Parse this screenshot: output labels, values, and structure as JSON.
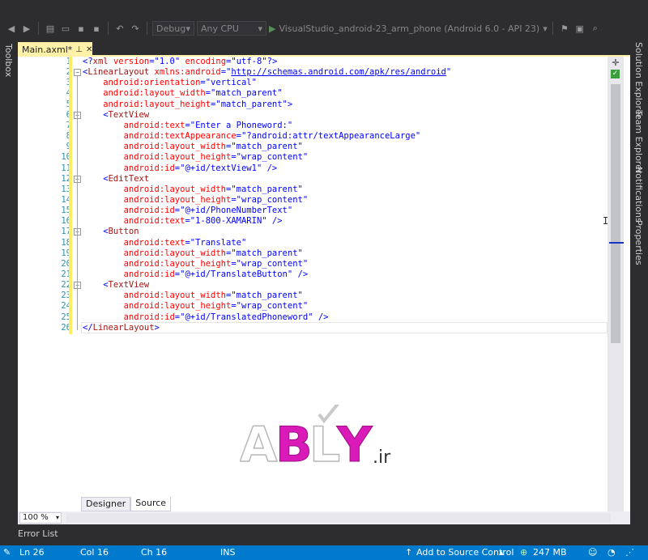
{
  "toolbar": {
    "config": "Debug",
    "platform": "Any CPU",
    "run_target": "VisualStudio_android-23_arm_phone (Android 6.0 - API 23)"
  },
  "side": {
    "left": "Toolbox",
    "right": [
      "Solution Explorer",
      "Team Explorer",
      "Notifications",
      "Properties"
    ]
  },
  "document_tab": {
    "title": "Main.axml*"
  },
  "editor": {
    "line_numbers": [
      "1",
      "2",
      "3",
      "4",
      "5",
      "6",
      "7",
      "8",
      "9",
      "10",
      "11",
      "12",
      "13",
      "14",
      "15",
      "16",
      "17",
      "18",
      "19",
      "20",
      "21",
      "22",
      "23",
      "24",
      "25",
      "26"
    ],
    "lines": [
      [
        {
          "t": "<?",
          "c": "brk"
        },
        {
          "t": "xml",
          "c": "tag"
        },
        {
          "t": " version",
          "c": "attr"
        },
        {
          "t": "=",
          "c": "brk"
        },
        {
          "t": "\"1.0\"",
          "c": "val"
        },
        {
          "t": " encoding",
          "c": "attr"
        },
        {
          "t": "=",
          "c": "brk"
        },
        {
          "t": "\"utf-8\"",
          "c": "val"
        },
        {
          "t": "?>",
          "c": "brk"
        }
      ],
      [
        {
          "t": "<",
          "c": "brk"
        },
        {
          "t": "LinearLayout",
          "c": "tag"
        },
        {
          "t": " xmlns:android",
          "c": "attr"
        },
        {
          "t": "=",
          "c": "brk"
        },
        {
          "t": "\"",
          "c": "val"
        },
        {
          "t": "http://schemas.android.com/apk/res/android",
          "c": "link"
        },
        {
          "t": "\"",
          "c": "val"
        }
      ],
      [
        {
          "t": "    android:orientation",
          "c": "attr"
        },
        {
          "t": "=",
          "c": "brk"
        },
        {
          "t": "\"vertical\"",
          "c": "val"
        }
      ],
      [
        {
          "t": "    android:layout_width",
          "c": "attr"
        },
        {
          "t": "=",
          "c": "brk"
        },
        {
          "t": "\"match_parent\"",
          "c": "val"
        }
      ],
      [
        {
          "t": "    android:layout_height",
          "c": "attr"
        },
        {
          "t": "=",
          "c": "brk"
        },
        {
          "t": "\"match_parent\"",
          "c": "val"
        },
        {
          "t": ">",
          "c": "brk"
        }
      ],
      [
        {
          "t": "    <",
          "c": "brk"
        },
        {
          "t": "TextView",
          "c": "tag"
        }
      ],
      [
        {
          "t": "        android:text",
          "c": "attr"
        },
        {
          "t": "=",
          "c": "brk"
        },
        {
          "t": "\"Enter a Phoneword:\"",
          "c": "val"
        }
      ],
      [
        {
          "t": "        android:textAppearance",
          "c": "attr"
        },
        {
          "t": "=",
          "c": "brk"
        },
        {
          "t": "\"?android:attr/textAppearanceLarge\"",
          "c": "val"
        }
      ],
      [
        {
          "t": "        android:layout_width",
          "c": "attr"
        },
        {
          "t": "=",
          "c": "brk"
        },
        {
          "t": "\"match_parent\"",
          "c": "val"
        }
      ],
      [
        {
          "t": "        android:layout_height",
          "c": "attr"
        },
        {
          "t": "=",
          "c": "brk"
        },
        {
          "t": "\"wrap_content\"",
          "c": "val"
        }
      ],
      [
        {
          "t": "        android:id",
          "c": "attr"
        },
        {
          "t": "=",
          "c": "brk"
        },
        {
          "t": "\"@+id/textView1\"",
          "c": "val"
        },
        {
          "t": " />",
          "c": "brk"
        }
      ],
      [
        {
          "t": "    <",
          "c": "brk"
        },
        {
          "t": "EditText",
          "c": "tag"
        }
      ],
      [
        {
          "t": "        android:layout_width",
          "c": "attr"
        },
        {
          "t": "=",
          "c": "brk"
        },
        {
          "t": "\"match_parent\"",
          "c": "val"
        }
      ],
      [
        {
          "t": "        android:layout_height",
          "c": "attr"
        },
        {
          "t": "=",
          "c": "brk"
        },
        {
          "t": "\"wrap_content\"",
          "c": "val"
        }
      ],
      [
        {
          "t": "        android:id",
          "c": "attr"
        },
        {
          "t": "=",
          "c": "brk"
        },
        {
          "t": "\"@+id/PhoneNumberText\"",
          "c": "val"
        }
      ],
      [
        {
          "t": "        android:text",
          "c": "attr"
        },
        {
          "t": "=",
          "c": "brk"
        },
        {
          "t": "\"1-800-XAMARIN\"",
          "c": "val"
        },
        {
          "t": " />",
          "c": "brk"
        }
      ],
      [
        {
          "t": "    <",
          "c": "brk"
        },
        {
          "t": "Button",
          "c": "tag"
        }
      ],
      [
        {
          "t": "        android:text",
          "c": "attr"
        },
        {
          "t": "=",
          "c": "brk"
        },
        {
          "t": "\"Translate\"",
          "c": "val"
        }
      ],
      [
        {
          "t": "        android:layout_width",
          "c": "attr"
        },
        {
          "t": "=",
          "c": "brk"
        },
        {
          "t": "\"match_parent\"",
          "c": "val"
        }
      ],
      [
        {
          "t": "        android:layout_height",
          "c": "attr"
        },
        {
          "t": "=",
          "c": "brk"
        },
        {
          "t": "\"wrap_content\"",
          "c": "val"
        }
      ],
      [
        {
          "t": "        android:id",
          "c": "attr"
        },
        {
          "t": "=",
          "c": "brk"
        },
        {
          "t": "\"@+id/TranslateButton\"",
          "c": "val"
        },
        {
          "t": " />",
          "c": "brk"
        }
      ],
      [
        {
          "t": "    <",
          "c": "brk"
        },
        {
          "t": "TextView",
          "c": "tag"
        }
      ],
      [
        {
          "t": "        android:layout_width",
          "c": "attr"
        },
        {
          "t": "=",
          "c": "brk"
        },
        {
          "t": "\"match_parent\"",
          "c": "val"
        }
      ],
      [
        {
          "t": "        android:layout_height",
          "c": "attr"
        },
        {
          "t": "=",
          "c": "brk"
        },
        {
          "t": "\"wrap_content\"",
          "c": "val"
        }
      ],
      [
        {
          "t": "        android:id",
          "c": "attr"
        },
        {
          "t": "=",
          "c": "brk"
        },
        {
          "t": "\"@+id/TranslatedPhoneword\"",
          "c": "val"
        },
        {
          "t": " />",
          "c": "brk"
        }
      ],
      [
        {
          "t": "</",
          "c": "brk"
        },
        {
          "t": "LinearLayout",
          "c": "tag"
        },
        {
          "t": ">",
          "c": "brk"
        }
      ]
    ]
  },
  "watermark": {
    "brand": "ABLY",
    "suffix": ".ir"
  },
  "view_tabs": {
    "designer": "Designer",
    "source": "Source"
  },
  "zoom": "100 %",
  "error_list": "Error List",
  "status": {
    "ln": "Ln 26",
    "col": "Col 16",
    "ch": "Ch 16",
    "mode": "INS",
    "source_control": "Add to Source Control",
    "memory": "247 MB"
  },
  "colors": {
    "status_bar": "#007acc",
    "tab_active": "#fff1a8",
    "ide_dark": "#2d2d30"
  }
}
